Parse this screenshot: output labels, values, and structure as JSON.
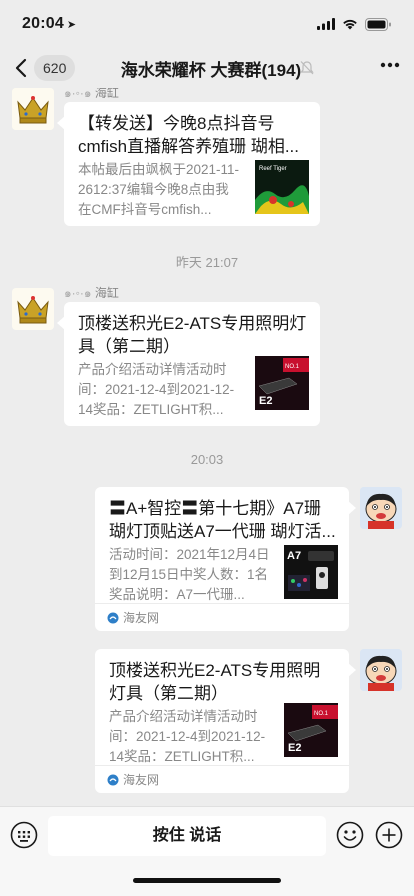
{
  "status": {
    "time": "20:04"
  },
  "nav": {
    "unread_count": "620",
    "title": "海水荣耀杯 大赛群(194)"
  },
  "messages": [
    {
      "sender": "海缸",
      "title": "【转发送】今晚8点抖音号cmfish直播解答养殖珊 瑚相...",
      "desc": "本帖最后由飒枫于2021-11-2612:37编辑今晚8点由我在CMF抖音号cmfish...",
      "thumb_text": "Reef Tiger"
    },
    {
      "sender": "海缸",
      "title": "顶楼送积光E2-ATS专用照明灯具（第二期）",
      "desc": "产品介绍活动详情活动时间：2021-12-4到2021-12-14奖品：ZETLIGHT积...",
      "thumb_text": "E2"
    },
    {
      "title": "〓A+智控〓第十七期》A7珊瑚灯顶贴送A7一代珊 瑚灯活...",
      "desc": "活动时间：2021年12月4日到12月15日中奖人数：1名奖品说明：A7一代珊...",
      "thumb_text": "A7",
      "source": "海友网"
    },
    {
      "title": "顶楼送积光E2-ATS专用照明灯具（第二期）",
      "desc": "产品介绍活动详情活动时间：2021-12-4到2021-12-14奖品：ZETLIGHT积...",
      "thumb_text": "E2",
      "source": "海友网"
    }
  ],
  "timestamps": [
    "昨天 21:07",
    "20:03"
  ],
  "input": {
    "hold_to_talk": "按住 说话"
  },
  "colors": {
    "background": "#ededed",
    "bubble": "#ffffff",
    "meta_text": "#888888"
  }
}
